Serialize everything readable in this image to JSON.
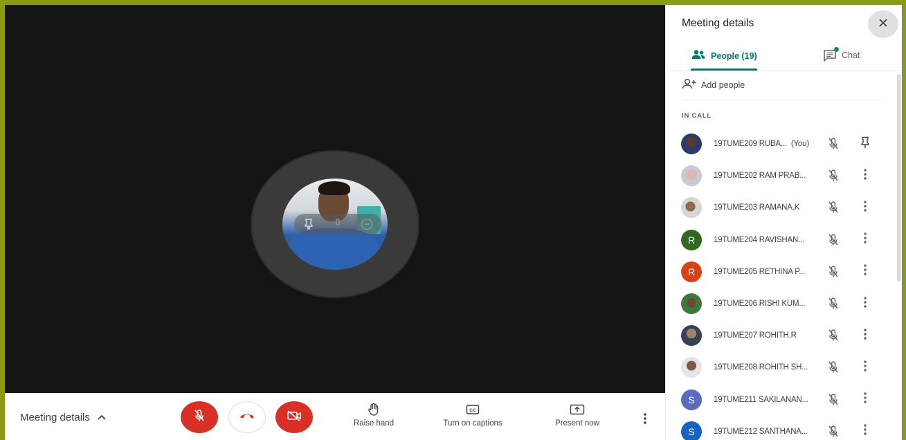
{
  "meeting": {
    "details_label": "Meeting details"
  },
  "controls": {
    "mic": {
      "icon": "mic-off-icon",
      "color": "#d93025"
    },
    "hangup": {
      "icon": "call-end-icon",
      "color": "#d93025"
    },
    "camera": {
      "icon": "videocam-off-icon",
      "color": "#d93025"
    },
    "raise_hand_label": "Raise hand",
    "captions_label": "Turn on captions",
    "present_label": "Present now"
  },
  "panel": {
    "title": "Meeting details",
    "tabs": [
      {
        "label": "People (19)",
        "icon": "people-icon",
        "active": true
      },
      {
        "label": "Chat",
        "icon": "chat-icon",
        "active": false
      }
    ],
    "add_people_label": "Add people",
    "section_label": "IN CALL",
    "accent": "#00796b"
  },
  "participants": [
    {
      "name": "19TUME209 RUBA...",
      "suffix": "(You)",
      "avatar": "photo",
      "action": "pin-icon"
    },
    {
      "name": "19TUME202 RAM PRAB...",
      "avatar": "photo",
      "action": "more-vert-icon"
    },
    {
      "name": "19TUME203 RAMANA.K",
      "avatar": "photo",
      "action": "more-vert-icon"
    },
    {
      "name": "19TUME204 RAVISHAN...",
      "avatar": "R",
      "avatar_color": "#33691e",
      "action": "more-vert-icon"
    },
    {
      "name": "19TUME205 RETHINA P...",
      "avatar": "R",
      "avatar_color": "#d84315",
      "action": "more-vert-icon"
    },
    {
      "name": "19TUME206 RISHI KUM...",
      "avatar": "photo",
      "action": "more-vert-icon"
    },
    {
      "name": "19TUME207 ROHITH.R",
      "avatar": "photo",
      "action": "more-vert-icon"
    },
    {
      "name": "19TUME208 ROHITH SH...",
      "avatar": "photo",
      "action": "more-vert-icon"
    },
    {
      "name": "19TUME211 SAKILANAN...",
      "avatar": "S",
      "avatar_color": "#5c6bc0",
      "action": "more-vert-icon"
    },
    {
      "name": "19TUME212 SANTHANA...",
      "avatar": "S",
      "avatar_color": "#1565c0",
      "action": "more-vert-icon"
    }
  ]
}
